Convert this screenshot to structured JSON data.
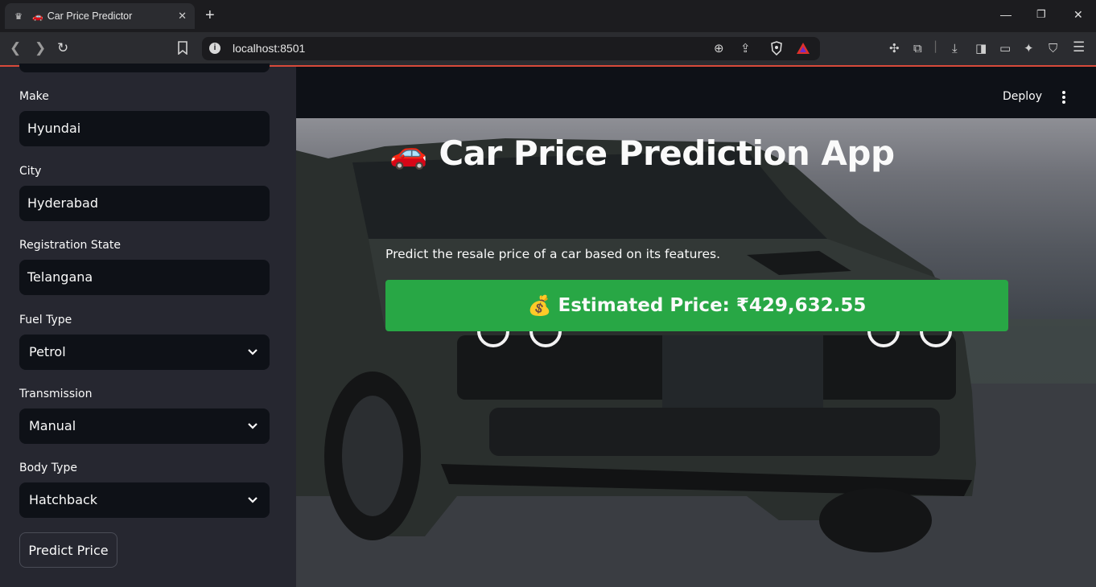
{
  "browser": {
    "tab_title": "Car Price Predictor",
    "tab_emoji": "🚗",
    "new_tab": "+",
    "url": "localhost:8501",
    "icons": [
      "back-icon",
      "forward-icon",
      "reload-icon",
      "bookmark-icon",
      "info-icon",
      "zoom-icon",
      "share-icon",
      "brave-shield-icon",
      "brave-rewards-icon",
      "extensions-icon",
      "screenshot-icon",
      "download-icon",
      "sidebar-icon",
      "wallet-icon",
      "leo-icon",
      "vpn-icon",
      "menu-icon"
    ]
  },
  "sidebar": {
    "fields": [
      {
        "label": "Make",
        "value": "Hyundai",
        "type": "text"
      },
      {
        "label": "City",
        "value": "Hyderabad",
        "type": "text"
      },
      {
        "label": "Registration State",
        "value": "Telangana",
        "type": "text"
      },
      {
        "label": "Fuel Type",
        "value": "Petrol",
        "type": "select"
      },
      {
        "label": "Transmission",
        "value": "Manual",
        "type": "select"
      },
      {
        "label": "Body Type",
        "value": "Hatchback",
        "type": "select"
      }
    ],
    "predict_label": "Predict Price"
  },
  "header": {
    "deploy_label": "Deploy"
  },
  "main": {
    "title_emoji": "🚗",
    "title": "Car Price Prediction App",
    "subtitle": "Predict the resale price of a car based on its features.",
    "result_emoji": "💰",
    "result_text": "Estimated Price: ₹429,632.55"
  },
  "colors": {
    "app_bg": "#0e1117",
    "sidebar_bg": "#262730",
    "success": "#28a745",
    "text": "#fafafa"
  }
}
